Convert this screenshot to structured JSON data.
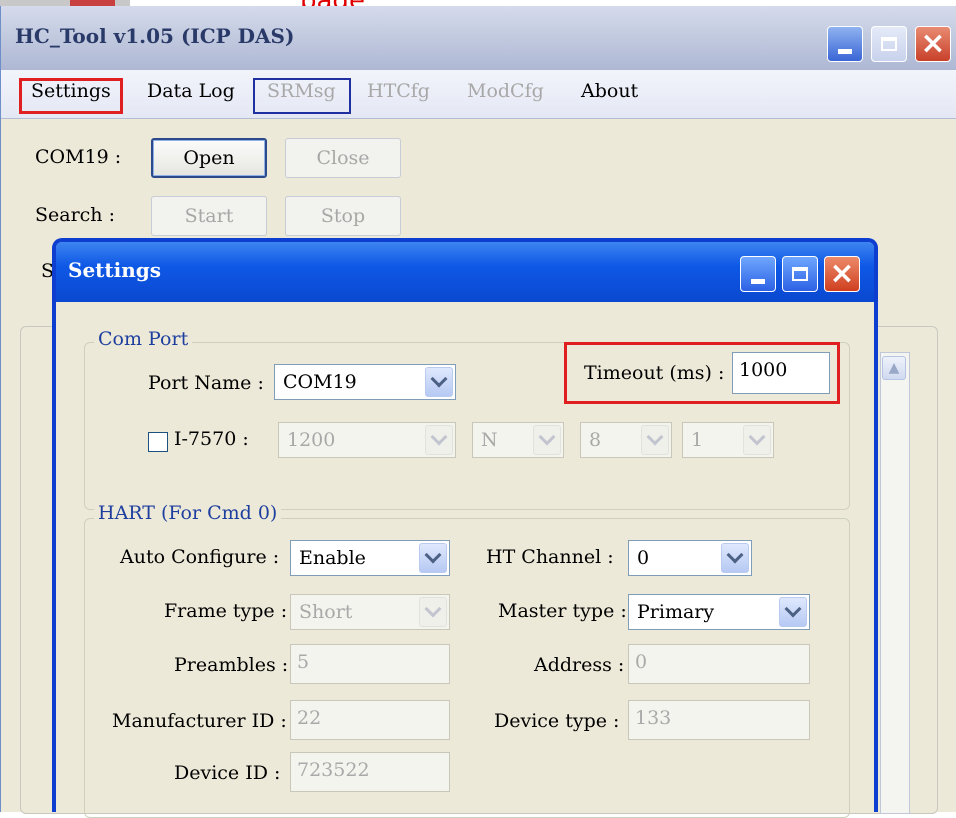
{
  "top_caption": "page",
  "main_window": {
    "title": "HC_Tool v1.05  (ICP DAS)",
    "menu": [
      {
        "label": "Settings",
        "enabled": true
      },
      {
        "label": "Data Log",
        "enabled": true
      },
      {
        "label": "SRMsg",
        "enabled": false
      },
      {
        "label": "HTCfg",
        "enabled": false
      },
      {
        "label": "ModCfg",
        "enabled": false
      },
      {
        "label": "About",
        "enabled": true
      }
    ],
    "com_label": "COM19 :",
    "open_button": "Open",
    "close_button": "Close",
    "search_label": "Search :",
    "start_button": "Start",
    "stop_button": "Stop",
    "clipped_label": "S"
  },
  "settings_dialog": {
    "title": "Settings",
    "com_port": {
      "group_title": "Com Port",
      "port_name_label": "Port Name :",
      "port_name_value": "COM19",
      "timeout_label": "Timeout (ms) :",
      "timeout_value": "1000",
      "i7570_label": "I-7570 :",
      "i7570_checked": false,
      "baud_value": "1200",
      "parity_value": "N",
      "data_bits_value": "8",
      "stop_bits_value": "1"
    },
    "hart": {
      "group_title": "HART (For Cmd 0)",
      "auto_configure_label": "Auto Configure :",
      "auto_configure_value": "Enable",
      "ht_channel_label": "HT Channel :",
      "ht_channel_value": "0",
      "frame_type_label": "Frame type :",
      "frame_type_value": "Short",
      "master_type_label": "Master type :",
      "master_type_value": "Primary",
      "preambles_label": "Preambles :",
      "preambles_value": "5",
      "address_label": "Address :",
      "address_value": "0",
      "manufacturer_id_label": "Manufacturer ID :",
      "manufacturer_id_value": "22",
      "device_type_label": "Device type :",
      "device_type_value": "133",
      "device_id_label": "Device ID :",
      "device_id_value": "723522"
    }
  },
  "colors": {
    "highlight_red": "#e02020",
    "highlight_blue": "#2030a0",
    "dialog_title_blue": "#0e58e6",
    "group_title_blue": "#1f3f9f"
  }
}
